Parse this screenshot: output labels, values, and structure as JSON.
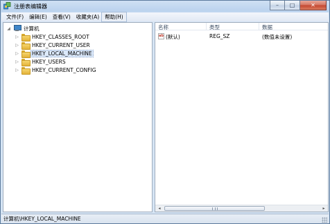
{
  "window": {
    "title": "注册表编辑器",
    "controls": {
      "minimize": "–",
      "maximize": "□",
      "close": "✕"
    }
  },
  "menu": [
    "文件(F)",
    "编辑(E)",
    "查看(V)",
    "收藏夹(A)",
    "帮助(H)"
  ],
  "menu_active_index": 4,
  "tree": {
    "root": "计算机",
    "root_expander": "◢",
    "items": [
      {
        "label": "HKEY_CLASSES_ROOT",
        "expander": "▷"
      },
      {
        "label": "HKEY_CURRENT_USER",
        "expander": "▷"
      },
      {
        "label": "HKEY_LOCAL_MACHINE",
        "expander": "▷",
        "selected": true
      },
      {
        "label": "HKEY_USERS",
        "expander": "▷"
      },
      {
        "label": "HKEY_CURRENT_CONFIG",
        "expander": "▷"
      }
    ]
  },
  "list": {
    "columns": [
      "名称",
      "类型",
      "数据"
    ],
    "rows": [
      {
        "icon": "ab",
        "name": "(默认)",
        "type": "REG_SZ",
        "data": "(数值未设置)"
      }
    ],
    "scroll": {
      "left_arrow": "◂",
      "right_arrow": "▸"
    }
  },
  "status": {
    "path": "计算机\\HKEY_LOCAL_MACHINE"
  },
  "colors": {
    "selection": "#dbe9fb",
    "title_gradient": "#bcd3ee",
    "folder": "#f6d66d"
  }
}
